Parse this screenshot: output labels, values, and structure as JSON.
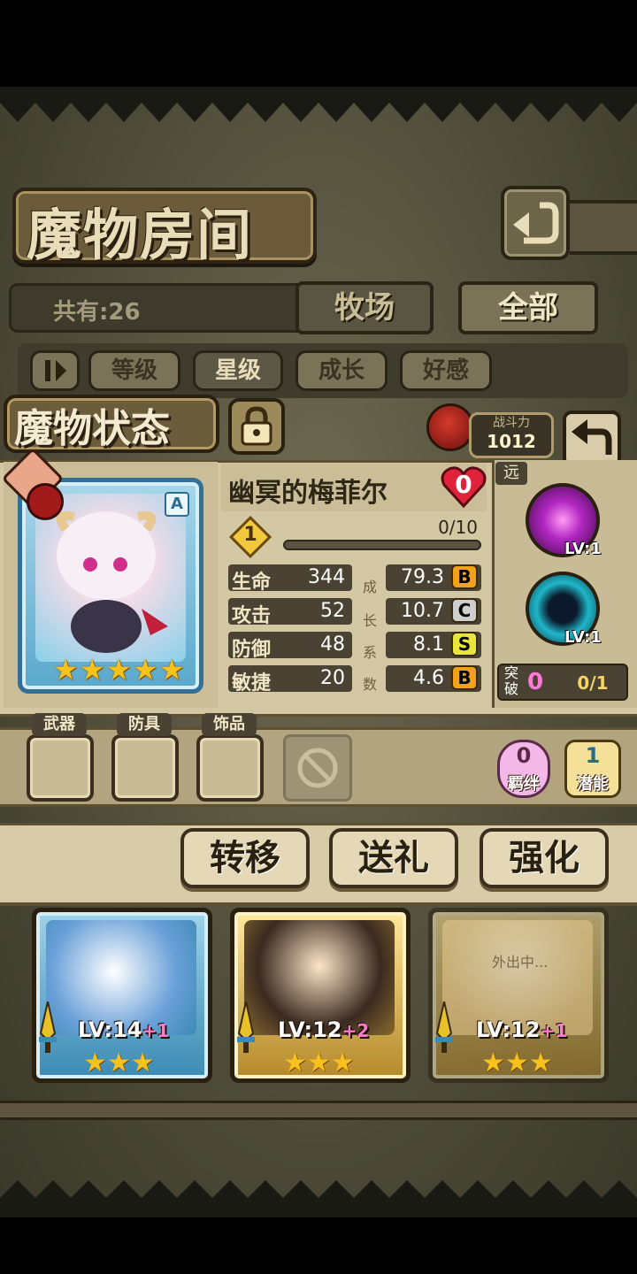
{
  "header": {
    "title": "魔物房间",
    "back_icon": "back-arrow-icon"
  },
  "inventory": {
    "count_text": "共有:26"
  },
  "tabs": [
    {
      "label": "牧场",
      "active": false
    },
    {
      "label": "全部",
      "active": true
    }
  ],
  "sort": {
    "toggle_icon": "pause-sort-icon",
    "options": [
      "等级",
      "星级",
      "成长",
      "好感"
    ],
    "active": "星级"
  },
  "status": {
    "label": "魔物状态",
    "lock_icon": "lock-icon",
    "power_label": "战斗力",
    "power_value": "1012",
    "return_icon": "return-arrow-icon"
  },
  "monster": {
    "name": "幽冥的梅菲尔",
    "affection": "0",
    "rank": "A",
    "stars": 5,
    "level": "1",
    "xp_text": "0/10",
    "xp_fraction": 0,
    "range_tag": "远",
    "stats": [
      {
        "name": "生命",
        "value": "344",
        "growth": "79.3",
        "grade": "B"
      },
      {
        "name": "攻击",
        "value": "52",
        "growth": "10.7",
        "grade": "C"
      },
      {
        "name": "防御",
        "value": "48",
        "growth": "8.1",
        "grade": "S"
      },
      {
        "name": "敏捷",
        "value": "20",
        "growth": "4.6",
        "grade": "B"
      }
    ],
    "growth_label": [
      "成",
      "长",
      "系",
      "数"
    ],
    "skills": [
      {
        "level_text": "LV:1",
        "color": "#c23ad8"
      },
      {
        "level_text": "LV:1",
        "color": "#1fb7c9"
      }
    ],
    "breakthrough": {
      "label": "突破",
      "count": "0",
      "progress": "0/1"
    }
  },
  "equipment": {
    "slots": [
      "武器",
      "防具",
      "饰品"
    ],
    "bond": {
      "count": "0",
      "label": "羁绊"
    },
    "potential": {
      "count": "1",
      "label": "潜能"
    }
  },
  "actions": [
    "转移",
    "送礼",
    "强化"
  ],
  "cards": [
    {
      "level": "LV:14",
      "plus": "+1",
      "stars": 3,
      "frame": "blue"
    },
    {
      "level": "LV:12",
      "plus": "+2",
      "stars": 3,
      "frame": "gold"
    },
    {
      "level": "LV:12",
      "plus": "+1",
      "stars": 3,
      "frame": "gold",
      "status": "外出中..."
    }
  ],
  "colors": {
    "panel": "#d4c7a4",
    "dark": "#2a2010",
    "star": "#f7c21c",
    "grade_B": "#f2a21a",
    "grade_C": "#cfcfcf",
    "grade_S": "#e8e63a"
  }
}
